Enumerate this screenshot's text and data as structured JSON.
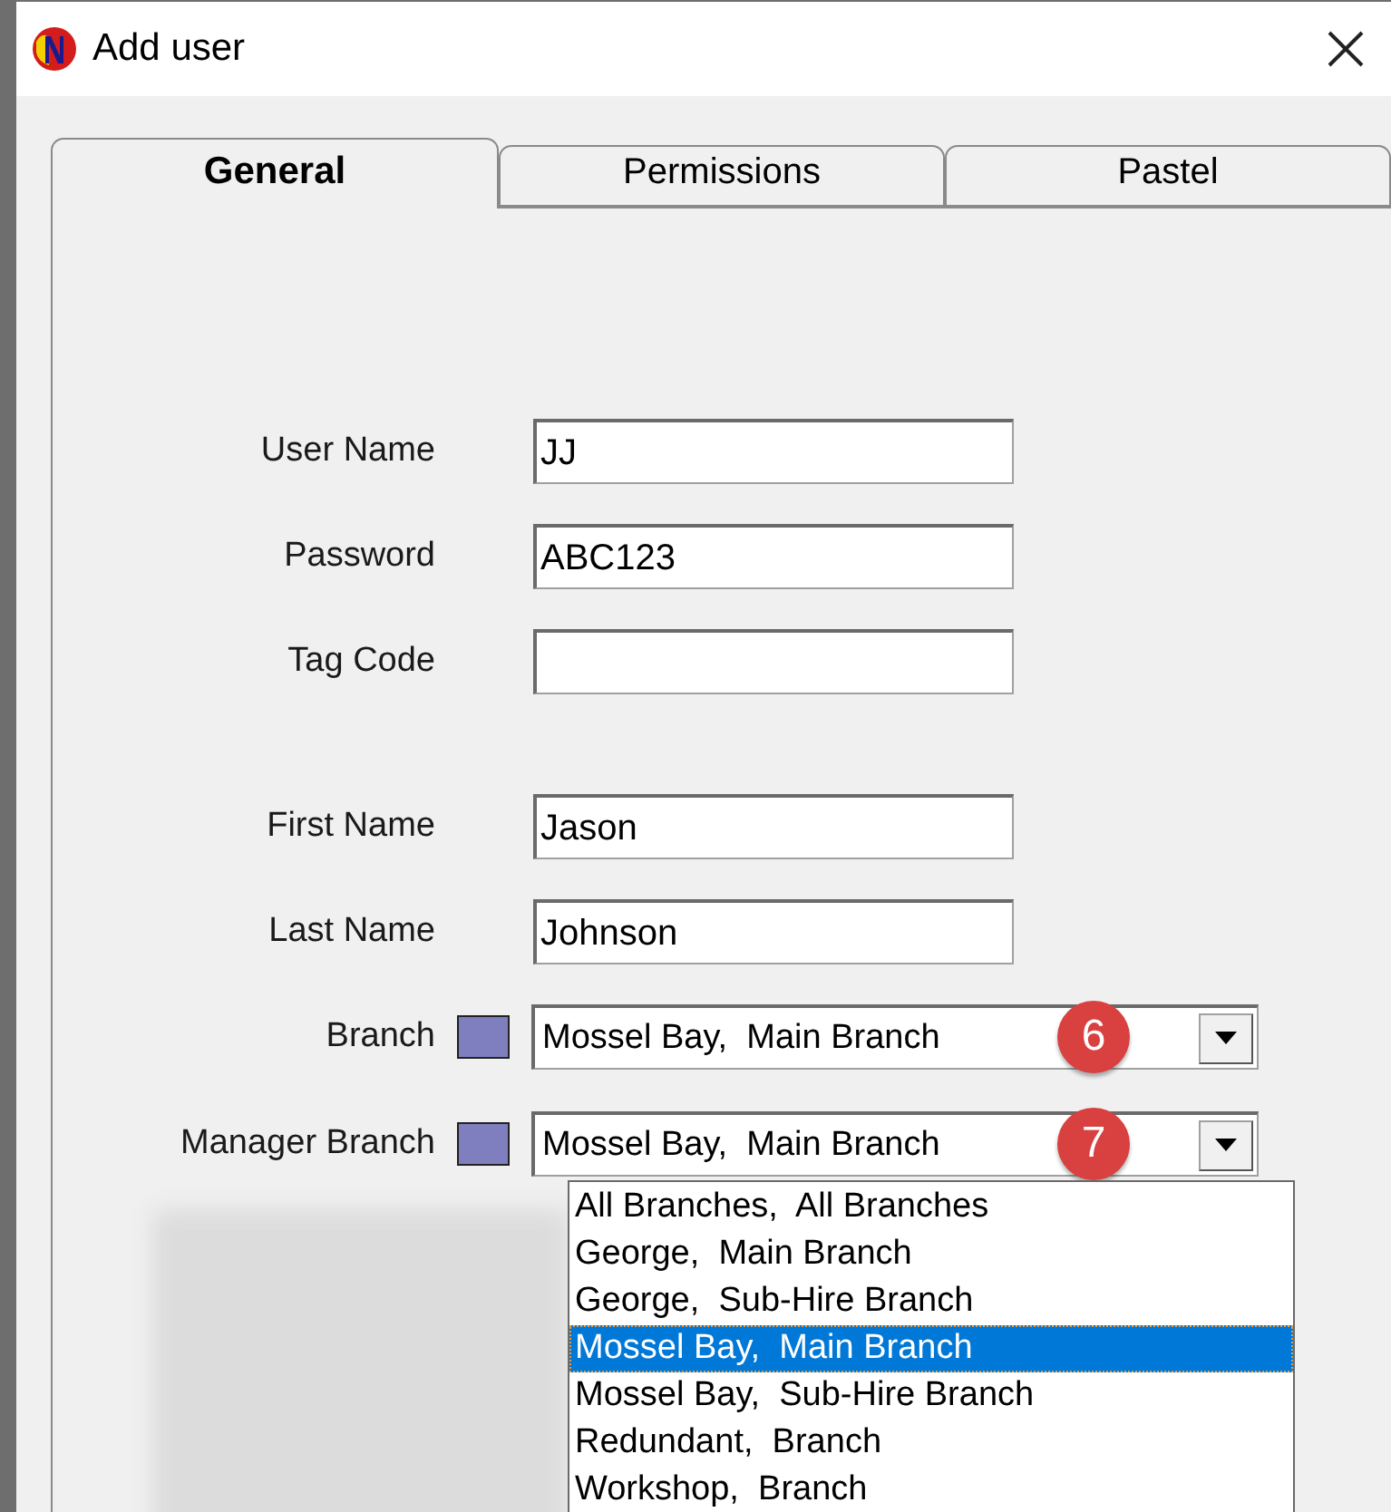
{
  "window": {
    "title": "Add user"
  },
  "tabs": [
    {
      "label": "General",
      "selected": true
    },
    {
      "label": "Permissions",
      "selected": false
    },
    {
      "label": "Pastel",
      "selected": false
    }
  ],
  "field_groups": [
    [
      {
        "label": "User Name",
        "value": "JJ"
      },
      {
        "label": "Password",
        "value": "ABC123"
      },
      {
        "label": "Tag Code"
      }
    ],
    [
      {
        "label": "First Name",
        "value": "Jason"
      },
      {
        "label": "Last Name",
        "value": "Johnson"
      }
    ]
  ],
  "combos": [
    {
      "label": "Branch",
      "color": "#7f7fc0",
      "value": "Mossel Bay,  Main Branch",
      "badge": "6"
    },
    {
      "label": "Manager Branch",
      "color": "#7f7fc0",
      "value": "Mossel Bay,  Main Branch",
      "badge": "7",
      "open_options": [
        {
          "label": "All Branches,  All Branches",
          "selected": false
        },
        {
          "label": "George,  Main Branch",
          "selected": false
        },
        {
          "label": "George,  Sub-Hire Branch",
          "selected": false
        },
        {
          "label": "Mossel Bay,  Main Branch",
          "selected": true
        },
        {
          "label": "Mossel Bay,  Sub-Hire Branch",
          "selected": false
        },
        {
          "label": "Redundant,  Branch",
          "selected": false
        },
        {
          "label": "Workshop,  Branch",
          "selected": false
        }
      ]
    }
  ]
}
